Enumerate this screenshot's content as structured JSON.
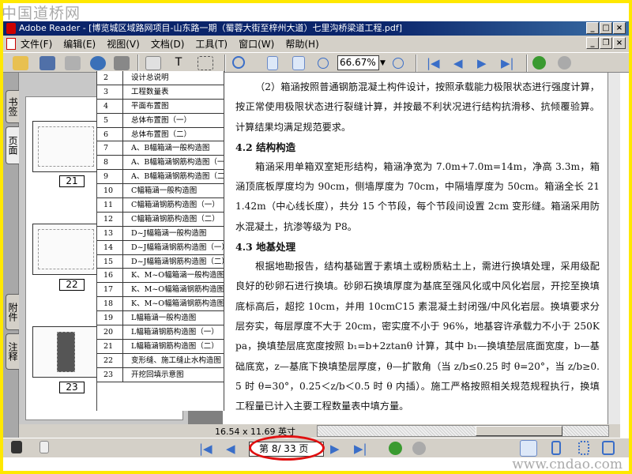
{
  "watermark_logo": "中国道桥网",
  "watermark_url": "www.cndao.com",
  "window": {
    "title": "Adobe Reader - [博览城区域路网项目-山东路一期（蜀蓉大街至梓州大道）七里沟桥梁道工程.pdf]"
  },
  "menu": [
    "文件(F)",
    "编辑(E)",
    "视图(V)",
    "文档(D)",
    "工具(T)",
    "窗口(W)",
    "帮助(H)"
  ],
  "toolbar": {
    "zoom": "66.67%"
  },
  "side_tabs": [
    "书签",
    "页面",
    "附件",
    "注释"
  ],
  "thumbnails": [
    "21",
    "22",
    "23"
  ],
  "drawing_list": [
    [
      "2",
      "设计总说明"
    ],
    [
      "3",
      "工程数量表"
    ],
    [
      "4",
      "平面布置图"
    ],
    [
      "5",
      "总体布置图（一）"
    ],
    [
      "6",
      "总体布置图（二）"
    ],
    [
      "7",
      "A、B幅箱涵一般构造图"
    ],
    [
      "8",
      "A、B幅箱涵钢筋构造图（一）"
    ],
    [
      "9",
      "A、B幅箱涵钢筋构造图（二）"
    ],
    [
      "10",
      "C幅箱涵一般构造图"
    ],
    [
      "11",
      "C幅箱涵钢筋构造图（一）"
    ],
    [
      "12",
      "C幅箱涵钢筋构造图（二）"
    ],
    [
      "13",
      "D~J幅箱涵一般构造图"
    ],
    [
      "14",
      "D~J幅箱涵钢筋构造图（一）"
    ],
    [
      "15",
      "D~J幅箱涵钢筋构造图（二）"
    ],
    [
      "16",
      "K、M~O幅箱涵一般构造图"
    ],
    [
      "17",
      "K、M~O幅箱涵钢筋构造图（一）"
    ],
    [
      "18",
      "K、M~O幅箱涵钢筋构造图（二）"
    ],
    [
      "19",
      "L幅箱涵一般构造图"
    ],
    [
      "20",
      "L幅箱涵钢筋构造图（一）"
    ],
    [
      "21",
      "L幅箱涵钢筋构造图（二）"
    ],
    [
      "22",
      "变形缝、施工缝止水构造图"
    ],
    [
      "23",
      "开挖回填示意图"
    ]
  ],
  "document": {
    "p1": "（2）箱涵按照普通钢筋混凝土构件设计，按照承载能力极限状态进行强度计算，按正常使用极限状态进行裂缝计算，并按最不利状况进行结构抗滑移、抗倾覆验算。计算结果均满足规范要求。",
    "h42": "4.2 结构构造",
    "p2": "箱涵采用单箱双室矩形结构，箱涵净宽为 7.0m+7.0m=14m，净高 3.3m，箱涵顶底板厚度均为 90cm，侧墙厚度为 70cm，中隔墙厚度为 50cm。箱涵全长 211.42m（中心线长度），共分 15 个节段，每个节段间设置 2cm 变形缝。箱涵采用防水混凝土，抗渗等级为 P8。",
    "h43": "4.3 地基处理",
    "p3": "根据地勘报告，结构基础置于素填土或粉质粘土上，需进行换填处理，采用级配良好的砂卵石进行换填。砂卵石换填厚度为基底至强风化或中风化岩层，开挖至换填底标高后，超挖 10cm，并用 10cmC15 素混凝土封闭强/中风化岩层。换填要求分层夯实，每层厚度不大于 20cm，密实度不小于 96%，地基容许承载力不小于 250Kpa，换填垫层底宽度按照 b₁=b+2ztanθ 计算，其中 b₁—换填垫层底面宽度，b—基础底宽，z—基底下换填垫层厚度，θ—扩散角（当 z/b≤0.25 时 θ=20°，当 z/b≥0.5 时 θ=30°，0.25＜z/b＜0.5 时 θ 内插）。施工严格按照相关规范规程执行，换填工程量已计入主要工程数量表中填方量。"
  },
  "page_size": "16.54 x 11.69 英寸",
  "status": {
    "page_indicator": "第 8/ 33 页"
  },
  "colors": {
    "border": "#ffe800",
    "titlebar": "#0a246a",
    "highlight_oval": "#e01010"
  }
}
